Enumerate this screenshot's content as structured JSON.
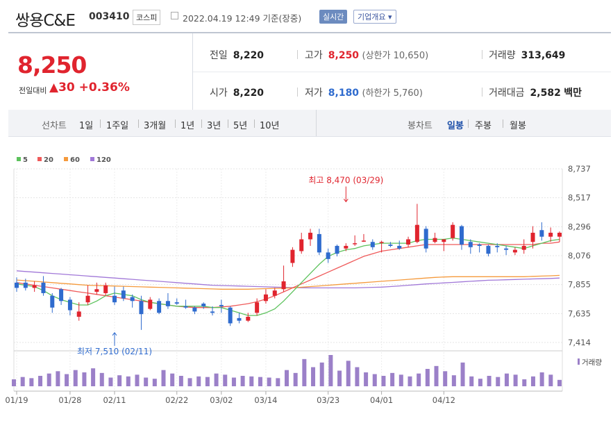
{
  "header": {
    "stock_name": "쌍용C&E",
    "stock_code": "003410",
    "market": "코스피",
    "datetime": "2022.04.19 12:49 기준(장중)",
    "realtime_label": "실시간",
    "company_info_label": "기업개요 ▾"
  },
  "summary": {
    "price": "8,250",
    "change_label": "전일대비",
    "change_value": "▲30",
    "change_pct": "+0.36%",
    "prev_close_label": "전일",
    "prev_close": "8,220",
    "open_label": "시가",
    "open": "8,220",
    "high_label": "고가",
    "high": "8,250",
    "upper_limit": "(상한가 10,650)",
    "low_label": "저가",
    "low": "8,180",
    "lower_limit": "(하한가 5,760)",
    "volume_label": "거래량",
    "volume": "313,649",
    "amount_label": "거래대금",
    "amount": "2,582",
    "amount_unit": "백만"
  },
  "toolbar": {
    "line_chart_label": "선차트",
    "line_periods": [
      "1일",
      "1주일",
      "3개월",
      "1년",
      "3년",
      "5년",
      "10년"
    ],
    "candle_chart_label": "봉차트",
    "candle_periods": [
      "일봉",
      "주봉",
      "월봉"
    ],
    "selected_candle": "일봉"
  },
  "colors": {
    "up": "#e0242e",
    "down": "#2f6bce",
    "ma5": "#5cc25c",
    "ma20": "#ef5a5a",
    "ma60": "#f59a3c",
    "ma120": "#a178d8",
    "volume": "#9b80c8"
  },
  "chart_data": {
    "type": "candlestick",
    "legend": [
      {
        "name": "5",
        "color": "#5cc25c"
      },
      {
        "name": "20",
        "color": "#ef5a5a"
      },
      {
        "name": "60",
        "color": "#f59a3c"
      },
      {
        "name": "120",
        "color": "#a178d8"
      }
    ],
    "y_ticks": [
      "8,737",
      "8,517",
      "8,296",
      "8,076",
      "7,855",
      "7,635",
      "7,414"
    ],
    "ylim": [
      7414,
      8737
    ],
    "x_ticks": [
      {
        "label": "01/19",
        "index": 0
      },
      {
        "label": "01/28",
        "index": 6
      },
      {
        "label": "02/11",
        "index": 11
      },
      {
        "label": "02/22",
        "index": 18
      },
      {
        "label": "03/02",
        "index": 23
      },
      {
        "label": "03/14",
        "index": 28
      },
      {
        "label": "03/23",
        "index": 35
      },
      {
        "label": "04/01",
        "index": 41
      },
      {
        "label": "04/12",
        "index": 48
      }
    ],
    "annotations": [
      {
        "text": "최고 8,470 (03/29)",
        "index": 37,
        "value": 8470,
        "color": "#e0242e"
      },
      {
        "text": "최저 7,510 (02/11)",
        "index": 11,
        "value": 7510,
        "color": "#2f6bce"
      }
    ],
    "volume_label": "거래량",
    "candles": [
      [
        7870,
        7830,
        7910,
        7800
      ],
      [
        7870,
        7830,
        7900,
        7810
      ],
      [
        7830,
        7850,
        7880,
        7800
      ],
      [
        7870,
        7790,
        7920,
        7770
      ],
      [
        7770,
        7680,
        7790,
        7640
      ],
      [
        7820,
        7730,
        7830,
        7700
      ],
      [
        7740,
        7660,
        7760,
        7620
      ],
      [
        7610,
        7650,
        7720,
        7580
      ],
      [
        7720,
        7770,
        7850,
        7700
      ],
      [
        7800,
        7820,
        7870,
        7780
      ],
      [
        7790,
        7850,
        7870,
        7770
      ],
      [
        7770,
        7720,
        7840,
        7700
      ],
      [
        7810,
        7750,
        7840,
        7730
      ],
      [
        7760,
        7730,
        7780,
        7680
      ],
      [
        7730,
        7630,
        7770,
        7510
      ],
      [
        7670,
        7740,
        7760,
        7660
      ],
      [
        7730,
        7640,
        7750,
        7630
      ],
      [
        7730,
        7690,
        7790,
        7670
      ],
      [
        7720,
        7710,
        7750,
        7700
      ],
      [
        7690,
        7680,
        7740,
        7670
      ],
      [
        7680,
        7650,
        7690,
        7630
      ],
      [
        7710,
        7690,
        7720,
        7670
      ],
      [
        7650,
        7640,
        7690,
        7620
      ],
      [
        7700,
        7690,
        7740,
        7640
      ],
      [
        7680,
        7560,
        7690,
        7540
      ],
      [
        7600,
        7580,
        7640,
        7560
      ],
      [
        7580,
        7610,
        7640,
        7570
      ],
      [
        7640,
        7720,
        7750,
        7620
      ],
      [
        7730,
        7780,
        7820,
        7710
      ],
      [
        7770,
        7810,
        7830,
        7750
      ],
      [
        7820,
        7880,
        8000,
        7800
      ],
      [
        8020,
        8120,
        8140,
        7990
      ],
      [
        8110,
        8200,
        8250,
        8090
      ],
      [
        8200,
        8250,
        8280,
        8150
      ],
      [
        8240,
        8100,
        8280,
        8080
      ],
      [
        8100,
        8050,
        8130,
        8020
      ],
      [
        8150,
        8090,
        8160,
        8070
      ],
      [
        8130,
        8150,
        8170,
        8110
      ],
      [
        8170,
        8170,
        8230,
        8150
      ],
      [
        8190,
        8190,
        8240,
        8180
      ],
      [
        8180,
        8140,
        8200,
        8120
      ],
      [
        8180,
        8180,
        8190,
        8100
      ],
      [
        8160,
        8150,
        8180,
        8140
      ],
      [
        8150,
        8130,
        8190,
        8120
      ],
      [
        8160,
        8200,
        8220,
        8140
      ],
      [
        8180,
        8310,
        8470,
        8170
      ],
      [
        8280,
        8130,
        8300,
        8100
      ],
      [
        8180,
        8210,
        8250,
        8170
      ],
      [
        8180,
        8200,
        8200,
        8110
      ],
      [
        8210,
        8310,
        8330,
        8190
      ],
      [
        8300,
        8160,
        8310,
        8120
      ],
      [
        8180,
        8140,
        8200,
        8090
      ],
      [
        8160,
        8150,
        8170,
        8100
      ],
      [
        8150,
        8090,
        8160,
        8070
      ],
      [
        8150,
        8140,
        8170,
        8100
      ],
      [
        8130,
        8120,
        8150,
        8080
      ],
      [
        8100,
        8120,
        8140,
        8080
      ],
      [
        8120,
        8150,
        8200,
        8090
      ],
      [
        8180,
        8250,
        8300,
        8130
      ],
      [
        8270,
        8220,
        8330,
        8190
      ],
      [
        8220,
        8250,
        8290,
        8180
      ],
      [
        8220,
        8250,
        8260,
        8180
      ]
    ],
    "ma5": [
      7860,
      7850,
      7840,
      7810,
      7770,
      7740,
      7720,
      7700,
      7700,
      7730,
      7770,
      7790,
      7780,
      7770,
      7740,
      7720,
      7710,
      7700,
      7690,
      7690,
      7690,
      7690,
      7680,
      7680,
      7660,
      7640,
      7620,
      7620,
      7640,
      7670,
      7730,
      7800,
      7870,
      7940,
      8010,
      8070,
      8100,
      8120,
      8130,
      8150,
      8160,
      8170,
      8170,
      8170,
      8170,
      8190,
      8200,
      8200,
      8200,
      8210,
      8200,
      8190,
      8180,
      8170,
      8160,
      8150,
      8140,
      8130,
      8150,
      8170,
      8190,
      8200
    ],
    "ma20": [
      7870,
      7860,
      7850,
      7840,
      7830,
      7820,
      7810,
      7800,
      7790,
      7780,
      7770,
      7760,
      7750,
      7740,
      7730,
      7720,
      7710,
      7700,
      7690,
      7685,
      7680,
      7680,
      7680,
      7685,
      7690,
      7700,
      7710,
      7725,
      7745,
      7770,
      7800,
      7830,
      7860,
      7890,
      7920,
      7950,
      7980,
      8010,
      8040,
      8070,
      8090,
      8110,
      8120,
      8130,
      8140,
      8150,
      8160,
      8160,
      8160,
      8160,
      8160,
      8160,
      8160,
      8160,
      8160,
      8160,
      8160,
      8160,
      8160,
      8170,
      8170,
      8180
    ],
    "ma60": [
      7890,
      7885,
      7880,
      7875,
      7870,
      7865,
      7860,
      7855,
      7850,
      7848,
      7846,
      7844,
      7842,
      7840,
      7838,
      7836,
      7834,
      7832,
      7830,
      7828,
      7826,
      7824,
      7822,
      7820,
      7820,
      7820,
      7820,
      7822,
      7824,
      7826,
      7828,
      7830,
      7835,
      7840,
      7845,
      7850,
      7855,
      7860,
      7865,
      7870,
      7875,
      7880,
      7885,
      7890,
      7895,
      7900,
      7905,
      7910,
      7913,
      7915,
      7915,
      7915,
      7915,
      7915,
      7915,
      7915,
      7915,
      7915,
      7918,
      7920,
      7922,
      7925
    ],
    "ma120": [
      7960,
      7955,
      7950,
      7945,
      7940,
      7935,
      7930,
      7925,
      7920,
      7915,
      7910,
      7905,
      7900,
      7895,
      7890,
      7885,
      7880,
      7875,
      7870,
      7865,
      7860,
      7855,
      7850,
      7848,
      7846,
      7844,
      7842,
      7840,
      7838,
      7836,
      7834,
      7832,
      7831,
      7830,
      7830,
      7830,
      7830,
      7830,
      7830,
      7832,
      7834,
      7836,
      7840,
      7845,
      7850,
      7855,
      7860,
      7864,
      7868,
      7872,
      7876,
      7880,
      7884,
      7888,
      7890,
      7892,
      7894,
      7896,
      7898,
      7900,
      7902,
      7905
    ],
    "volumes": [
      0.12,
      0.16,
      0.14,
      0.18,
      0.22,
      0.26,
      0.21,
      0.28,
      0.24,
      0.31,
      0.23,
      0.15,
      0.19,
      0.17,
      0.2,
      0.15,
      0.13,
      0.28,
      0.22,
      0.18,
      0.14,
      0.17,
      0.16,
      0.22,
      0.2,
      0.15,
      0.18,
      0.17,
      0.16,
      0.15,
      0.14,
      0.28,
      0.23,
      0.47,
      0.33,
      0.41,
      0.54,
      0.27,
      0.44,
      0.33,
      0.24,
      0.21,
      0.18,
      0.23,
      0.2,
      0.17,
      0.22,
      0.3,
      0.35,
      0.26,
      0.19,
      0.41,
      0.17,
      0.13,
      0.18,
      0.16,
      0.22,
      0.2,
      0.12,
      0.17,
      0.24,
      0.2,
      0.11
    ]
  }
}
